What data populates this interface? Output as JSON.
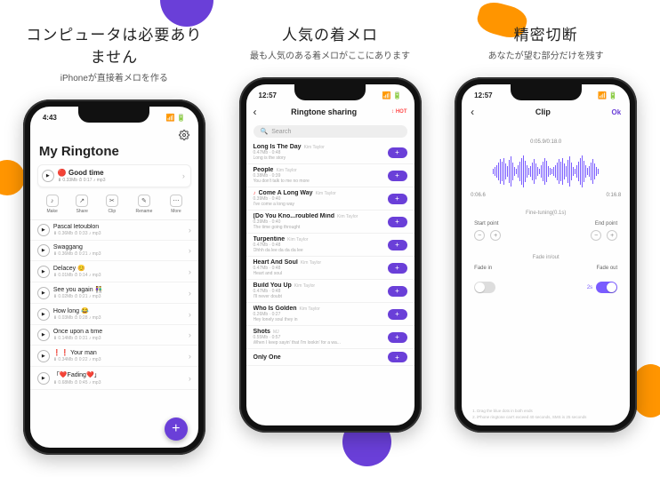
{
  "blobs": true,
  "shot1": {
    "headline": "コンピュータは必要ありません",
    "subline": "iPhoneが直接着メロを作る",
    "time": "4:43",
    "title": "My Ringtone",
    "featured": {
      "title": "🔴 Good time",
      "meta": "⬇ 0.33Mb   ⏱ 0:17   ♪ mp3"
    },
    "actions": [
      {
        "ico": "♪",
        "lbl": "Make"
      },
      {
        "ico": "↗",
        "lbl": "Share"
      },
      {
        "ico": "✂",
        "lbl": "Clip"
      },
      {
        "ico": "✎",
        "lbl": "Rename"
      },
      {
        "ico": "⋯",
        "lbl": "More"
      }
    ],
    "rows": [
      {
        "title": "Pascal letoublon",
        "meta": "⬇ 0.36Mb   ⏱ 0:33   ♪ mp3"
      },
      {
        "title": "Swaggang",
        "meta": "⬇ 0.36Mb   ⏱ 0:21   ♪ mp3"
      },
      {
        "title": "Delacey 😊",
        "meta": "⬇ 0.01Mb   ⏱ 0:14   ♪ mp3"
      },
      {
        "title": "See you again 👫",
        "meta": "⬇ 0.02Mb   ⏱ 0:21   ♪ mp3"
      },
      {
        "title": "How long 😂",
        "meta": "⬇ 0.03Mb   ⏱ 0:28   ♪ mp3"
      },
      {
        "title": "Once upon a time",
        "meta": "⬇ 0.14Mb   ⏱ 0:31   ♪ mp3"
      },
      {
        "title": "❗❗ Your man",
        "meta": "⬇ 0.34Mb   ⏱ 0:22   ♪ mp3"
      },
      {
        "title": "「❤️Fading❤️」",
        "meta": "⬇ 0.68Mb   ⏱ 0:45   ♪ mp3"
      }
    ]
  },
  "shot2": {
    "headline": "人気の着メロ",
    "subline": "最も人気のある着メロがここにあります",
    "time": "12:57",
    "nav_title": "Ringtone sharing",
    "hot": "HOT",
    "search_placeholder": "Search",
    "rows": [
      {
        "title": "Long Is The Day",
        "artist": "Kim Taylor",
        "meta": "0.47Mb · 0:48",
        "sub": "Long is the story"
      },
      {
        "title": "People",
        "artist": "Kim Taylor",
        "meta": "0.38Mb · 0:39",
        "sub": "You don't talk to me no more"
      },
      {
        "title": "Come A Long Way",
        "artist": "Kim Taylor",
        "meta": "0.39Mb · 0:40",
        "sub": "I've come a long way",
        "badge": "♪"
      },
      {
        "title": "(Do You Kno...roubled Mind",
        "artist": "Kim Taylor",
        "meta": "0.39Mb · 0:40",
        "sub": "The time going throught"
      },
      {
        "title": "Turpentine",
        "artist": "Kim Taylor",
        "meta": "0.47Mb · 0:48",
        "sub": "Ohhh da lee da da da lee"
      },
      {
        "title": "Heart And Soul",
        "artist": "Kim Taylor",
        "meta": "0.47Mb · 0:48",
        "sub": "Heart and soul"
      },
      {
        "title": "Build You Up",
        "artist": "Kim Taylor",
        "meta": "0.47Mb · 0:48",
        "sub": "I'll never doubt"
      },
      {
        "title": "Who Is Golden",
        "artist": "Kim Taylor",
        "meta": "0.26Mb · 0:27",
        "sub": "Hey lonely soul they in"
      },
      {
        "title": "Shots",
        "artist": "MJ",
        "meta": "0.55Mb · 0:57",
        "sub": "When I keep sayin' that I'm lookin' for a wa..."
      },
      {
        "title": "Only One",
        "artist": "",
        "meta": "",
        "sub": ""
      }
    ]
  },
  "shot3": {
    "headline": "精密切断",
    "subline": "あなたが望む部分だけを残す",
    "time": "12:57",
    "nav_title": "Clip",
    "ok": "Ok",
    "timecode": "0:05.9/0:18.0",
    "t_start": "0:06.6",
    "t_end": "0:16.8",
    "fine_label": "Fine-tuning(0.1s)",
    "start_label": "Start point",
    "end_label": "End point",
    "fade_section": "Fade in/out",
    "fade_in_lbl": "Fade in",
    "fade_out_lbl": "Fade out",
    "fade_out_val": "2s",
    "footnote1": "1.  Drag the blue dots in both ends",
    "footnote2": "2.  iPhone ringtone can't exceed 40 seconds, SMS is 25 seconds"
  }
}
